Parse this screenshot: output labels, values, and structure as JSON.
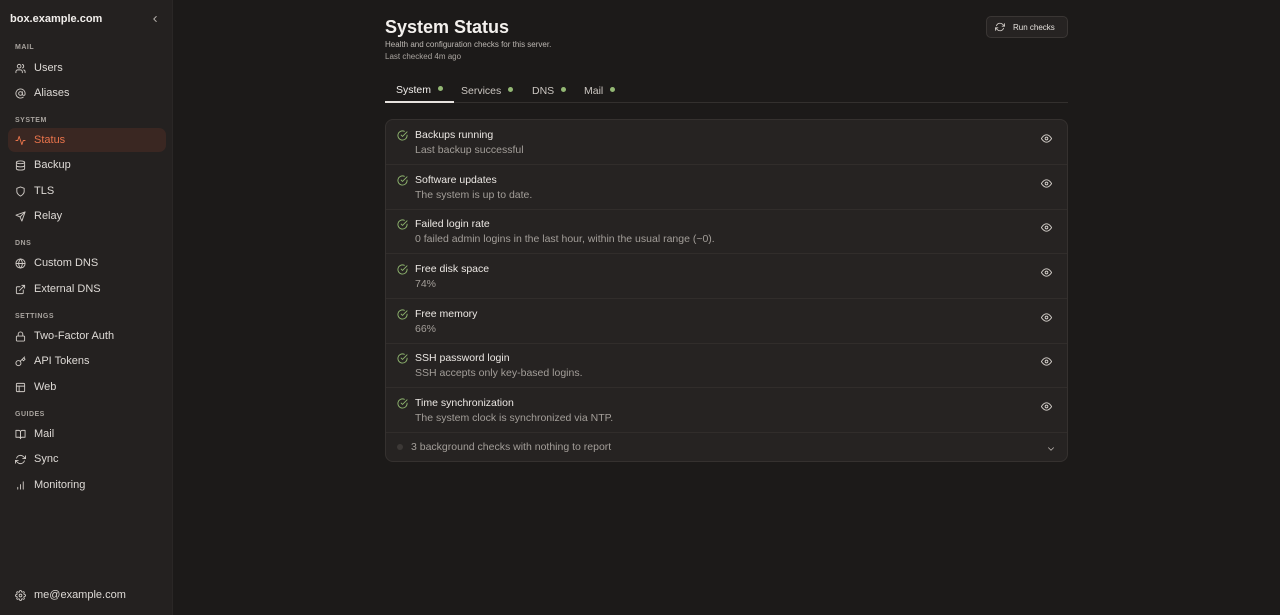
{
  "sidebar": {
    "brand": "box.example.com",
    "sections": {
      "mail": "MAIL",
      "system": "SYSTEM",
      "dns": "DNS",
      "settings": "SETTINGS",
      "guides": "GUIDES"
    },
    "items": {
      "users": "Users",
      "aliases": "Aliases",
      "status": "Status",
      "backup": "Backup",
      "tls": "TLS",
      "relay": "Relay",
      "custom_dns": "Custom DNS",
      "external_dns": "External DNS",
      "two_factor": "Two-Factor Auth",
      "api_tokens": "API Tokens",
      "web": "Web",
      "guide_mail": "Mail",
      "sync": "Sync",
      "monitoring": "Monitoring"
    },
    "active_item": "status",
    "user": "me@example.com"
  },
  "header": {
    "title": "System Status",
    "subtitle": "Health and configuration checks for this server.",
    "last_checked": "Last checked 4m ago",
    "run_button": "Run checks"
  },
  "tabs": [
    {
      "label": "System",
      "status": "ok",
      "active": true
    },
    {
      "label": "Services",
      "status": "ok",
      "active": false
    },
    {
      "label": "DNS",
      "status": "ok",
      "active": false
    },
    {
      "label": "Mail",
      "status": "ok",
      "active": false
    }
  ],
  "checks": [
    {
      "title": "Backups running",
      "detail": "Last backup successful",
      "status": "ok"
    },
    {
      "title": "Software updates",
      "detail": "The system is up to date.",
      "status": "ok"
    },
    {
      "title": "Failed login rate",
      "detail": "0 failed admin logins in the last hour, within the usual range (~0).",
      "status": "ok"
    },
    {
      "title": "Free disk space",
      "detail": "74%",
      "status": "ok"
    },
    {
      "title": "Free memory",
      "detail": "66%",
      "status": "ok"
    },
    {
      "title": "SSH password login",
      "detail": "SSH accepts only key-based logins.",
      "status": "ok"
    },
    {
      "title": "Time synchronization",
      "detail": "The system clock is synchronized via NTP.",
      "status": "ok"
    }
  ],
  "background_checks": "3 background checks with nothing to report",
  "colors": {
    "accent": "#e8734b",
    "ok": "#93b874",
    "background": "#1c1a19",
    "sidebar": "#242120"
  }
}
